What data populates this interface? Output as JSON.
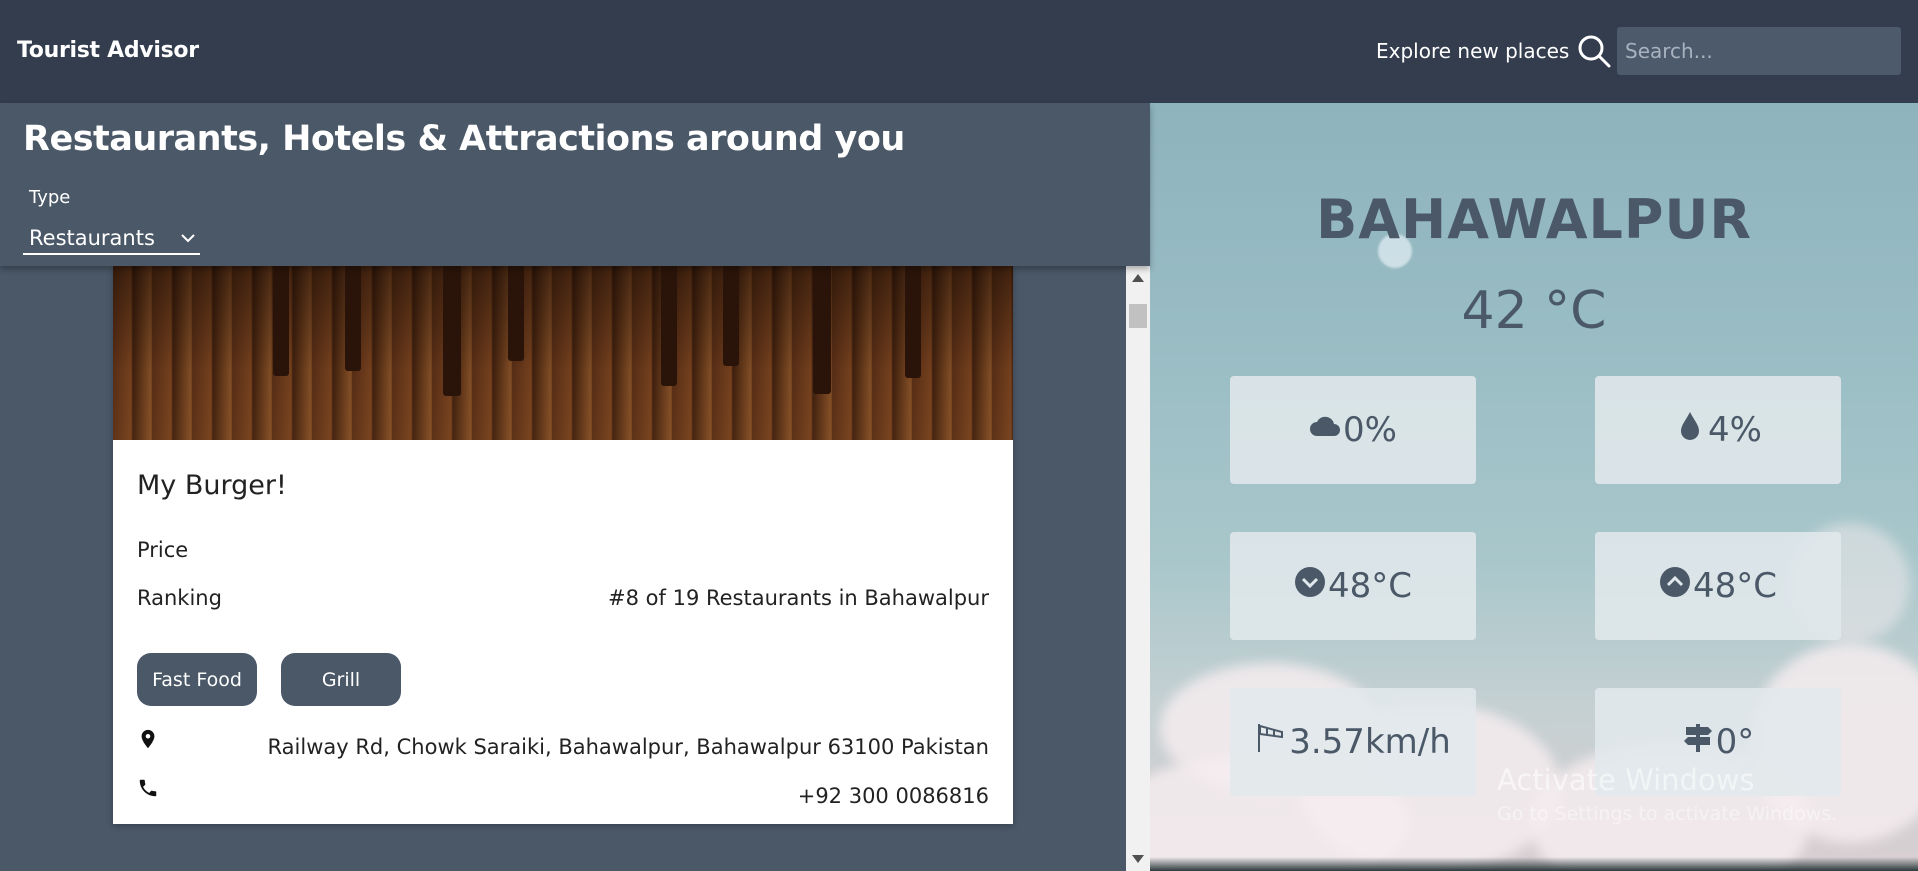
{
  "header": {
    "brand": "Tourist Advisor",
    "explore_label": "Explore new places",
    "search_placeholder": "Search..."
  },
  "list": {
    "title": "Restaurants, Hotels & Attractions around you",
    "type_label": "Type",
    "type_selected": "Restaurants"
  },
  "place": {
    "name": "My Burger!",
    "price_label": "Price",
    "ranking_label": "Ranking",
    "ranking_value": "#8 of 19 Restaurants in Bahawalpur",
    "tags": [
      "Fast Food",
      "Grill"
    ],
    "address": "Railway Rd, Chowk Saraiki, Bahawalpur, Bahawalpur 63100 Pakistan",
    "phone": "+92 300 0086816"
  },
  "weather": {
    "city": "BAHAWALPUR",
    "temperature": "42 °C",
    "clouds": "0%",
    "humidity": "4%",
    "temp_min": "48°C",
    "temp_max": "48°C",
    "wind_speed": "3.57km/h",
    "wind_direction": "0°"
  },
  "watermark": {
    "title": "Activate Windows",
    "subtitle": "Go to Settings to activate Windows."
  },
  "colors": {
    "topbar": "#333d4e",
    "panel": "#4a5868",
    "chip": "#4a5868"
  }
}
